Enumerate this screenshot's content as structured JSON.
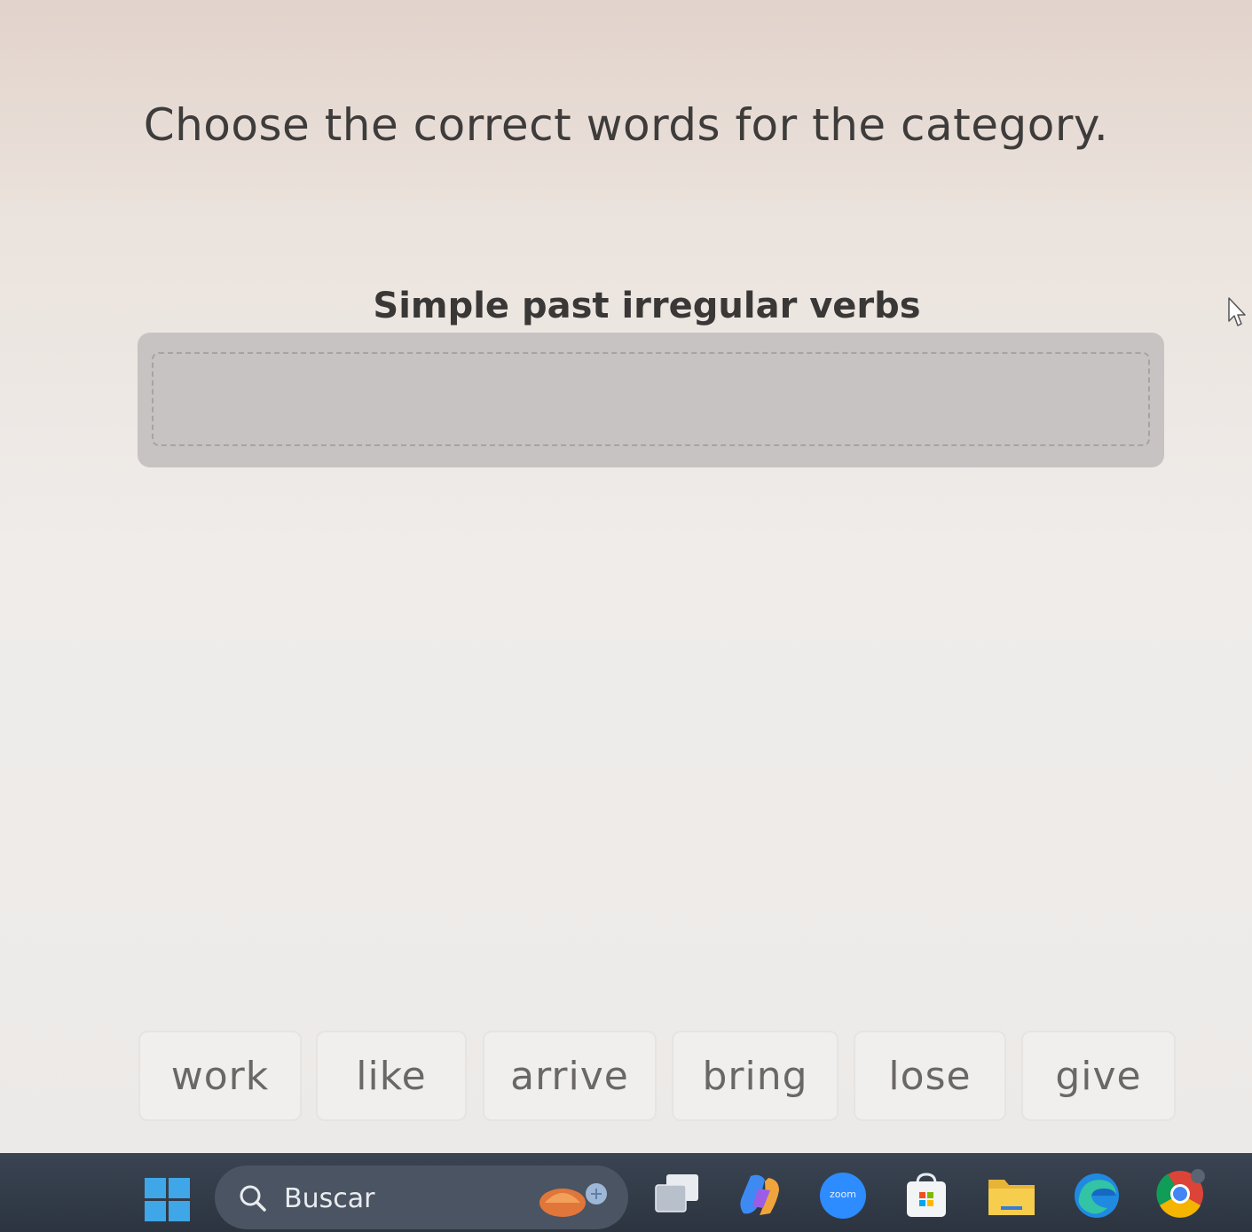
{
  "instruction": "Choose the correct words for the category.",
  "category": {
    "title": "Simple past irregular verbs",
    "placed_words": []
  },
  "word_bank": [
    {
      "id": "work",
      "label": "work"
    },
    {
      "id": "like",
      "label": "like"
    },
    {
      "id": "arrive",
      "label": "arrive"
    },
    {
      "id": "bring",
      "label": "bring"
    },
    {
      "id": "lose",
      "label": "lose"
    },
    {
      "id": "give",
      "label": "give"
    }
  ],
  "taskbar": {
    "search_label": "Buscar",
    "zoom_label": "zoom",
    "apps": [
      "windows-start-icon",
      "task-view-icon",
      "copilot-icon",
      "zoom-icon",
      "store-icon",
      "file-explorer-icon",
      "edge-icon",
      "chrome-icon"
    ]
  },
  "colors": {
    "drop_zone": "#c7c3c3",
    "card_bg": "#f0efee",
    "taskbar": "#323b48",
    "accent_blue": "#3fa6e8"
  }
}
